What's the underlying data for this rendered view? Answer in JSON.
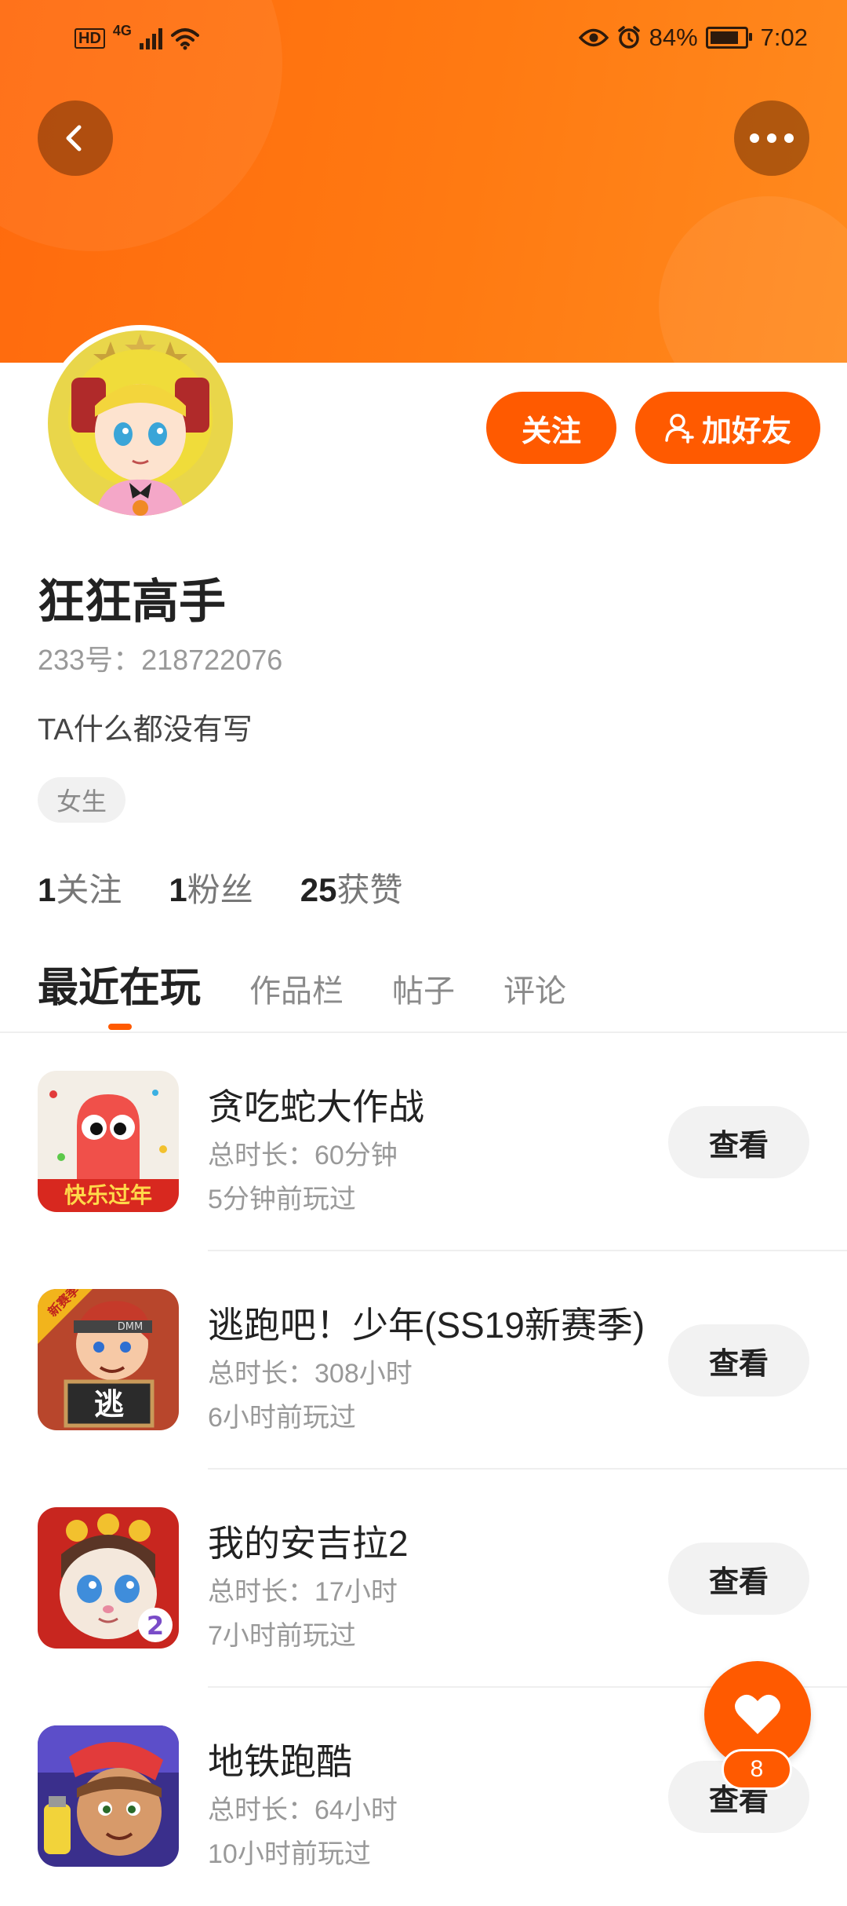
{
  "status_bar": {
    "hd": "HD",
    "network": "4G",
    "battery_percent": "84%",
    "battery_level": 0.84,
    "time": "7:02"
  },
  "header": {
    "back_icon": "chevron-left-icon",
    "more_icon": "more-horizontal-icon",
    "accent_color": "#ff6a0d"
  },
  "profile": {
    "name": "狂狂高手",
    "id_text": "233号：218722076",
    "bio": "TA什么都没有写",
    "gender_tag": "女生",
    "follow_button": "关注",
    "add_friend_button": "加好友"
  },
  "stats": [
    {
      "value": "1",
      "label": "关注"
    },
    {
      "value": "1",
      "label": "粉丝"
    },
    {
      "value": "25",
      "label": "获赞"
    }
  ],
  "tabs": [
    {
      "label": "最近在玩",
      "active": true
    },
    {
      "label": "作品栏",
      "active": false
    },
    {
      "label": "帖子",
      "active": false
    },
    {
      "label": "评论",
      "active": false
    }
  ],
  "games": [
    {
      "title": "贪吃蛇大作战",
      "duration": "总时长：60分钟",
      "last_played": "5分钟前玩过",
      "button": "查看",
      "icon_text": "快乐过年"
    },
    {
      "title": "逃跑吧！少年(SS19新赛季)",
      "duration": "总时长：308小时",
      "last_played": "6小时前玩过",
      "button": "查看",
      "icon_text": "逃",
      "icon_badge": "新赛季",
      "icon_brand": "DMM"
    },
    {
      "title": "我的安吉拉2",
      "duration": "总时长：17小时",
      "last_played": "7小时前玩过",
      "button": "查看",
      "icon_text": "2"
    },
    {
      "title": "地铁跑酷",
      "duration": "总时长：64小时",
      "last_played": "10小时前玩过",
      "button": "查看"
    }
  ],
  "fab": {
    "icon": "heart-icon",
    "badge": "8"
  }
}
